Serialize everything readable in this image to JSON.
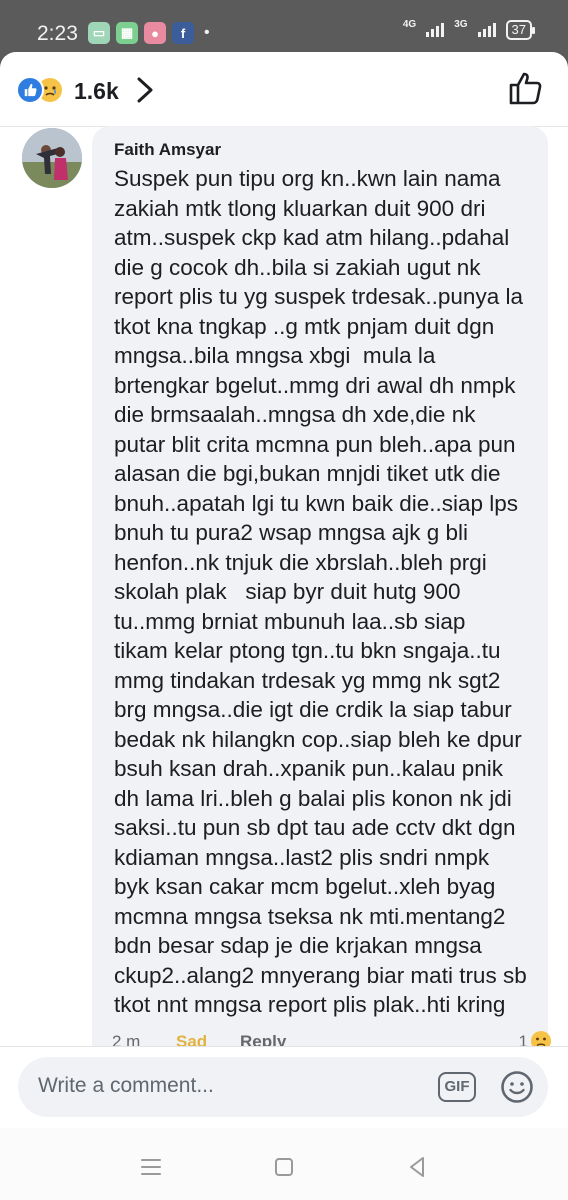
{
  "status_bar": {
    "time": "2:23",
    "network_1": "4G",
    "network_2": "3G",
    "battery": "37"
  },
  "reactions": {
    "count": "1.6k",
    "icons": [
      "like-icon",
      "sad-icon"
    ]
  },
  "comment": {
    "author": "Faith Amsyar",
    "lines": [
      "Suspek pun tipu org kn..kwn lain nama",
      "zakiah mtk tlong kluarkan duit 900 dri",
      "atm..suspek ckp kad atm hilang..pdahal",
      "die g cocok dh..bila si zakiah ugut nk",
      "report plis tu yg suspek trdesak..punya la",
      "tkot kna tngkap ..g mtk pnjam duit dgn",
      "mngsa..bila mngsa xbgi  mula la",
      "brtengkar bgelut..mmg dri awal dh nmpk",
      "die brmsaalah..mngsa dh xde,die nk",
      "putar blit crita mcmna pun bleh..apa pun",
      "alasan die bgi,bukan mnjdi tiket utk die",
      "bnuh..apatah lgi tu kwn baik die..siap lps",
      "bnuh tu pura2 wsap mngsa ajk g bli",
      "henfon..nk tnjuk die xbrslah..bleh prgi",
      "skolah plak   siap byr duit hutg 900",
      "tu..mmg brniat mbunuh laa..sb siap",
      "tikam kelar ptong tgn..tu bkn sngaja..tu",
      "mmg tindakan trdesak yg mmg nk sgt2",
      "brg mngsa..die igt die crdik la siap tabur",
      "bedak nk hilangkn cop..siap bleh ke dpur",
      "bsuh ksan drah..xpanik pun..kalau pnik",
      "dh lama lri..bleh g balai plis konon nk jdi",
      "saksi..tu pun sb dpt tau ade cctv dkt dgn",
      "kdiaman mngsa..last2 plis sndri nmpk",
      "byk ksan cakar mcm bgelut..xleh byag",
      "mcmna mngsa tseksa nk mti.mentang2",
      "bdn besar sdap je die krjakan mngsa",
      "ckup2..alang2 mnyerang biar mati trus sb",
      "tkot nnt mngsa report plis plak..hti kring"
    ],
    "time": "2 m",
    "reaction_label": "Sad",
    "reply_label": "Reply",
    "reaction_count": "1"
  },
  "composer": {
    "placeholder": "Write a comment...",
    "gif_label": "GIF"
  },
  "colors": {
    "accent_blue": "#2f7de1",
    "sad_yellow": "#f6c347",
    "bubble": "#f0f2f5"
  }
}
